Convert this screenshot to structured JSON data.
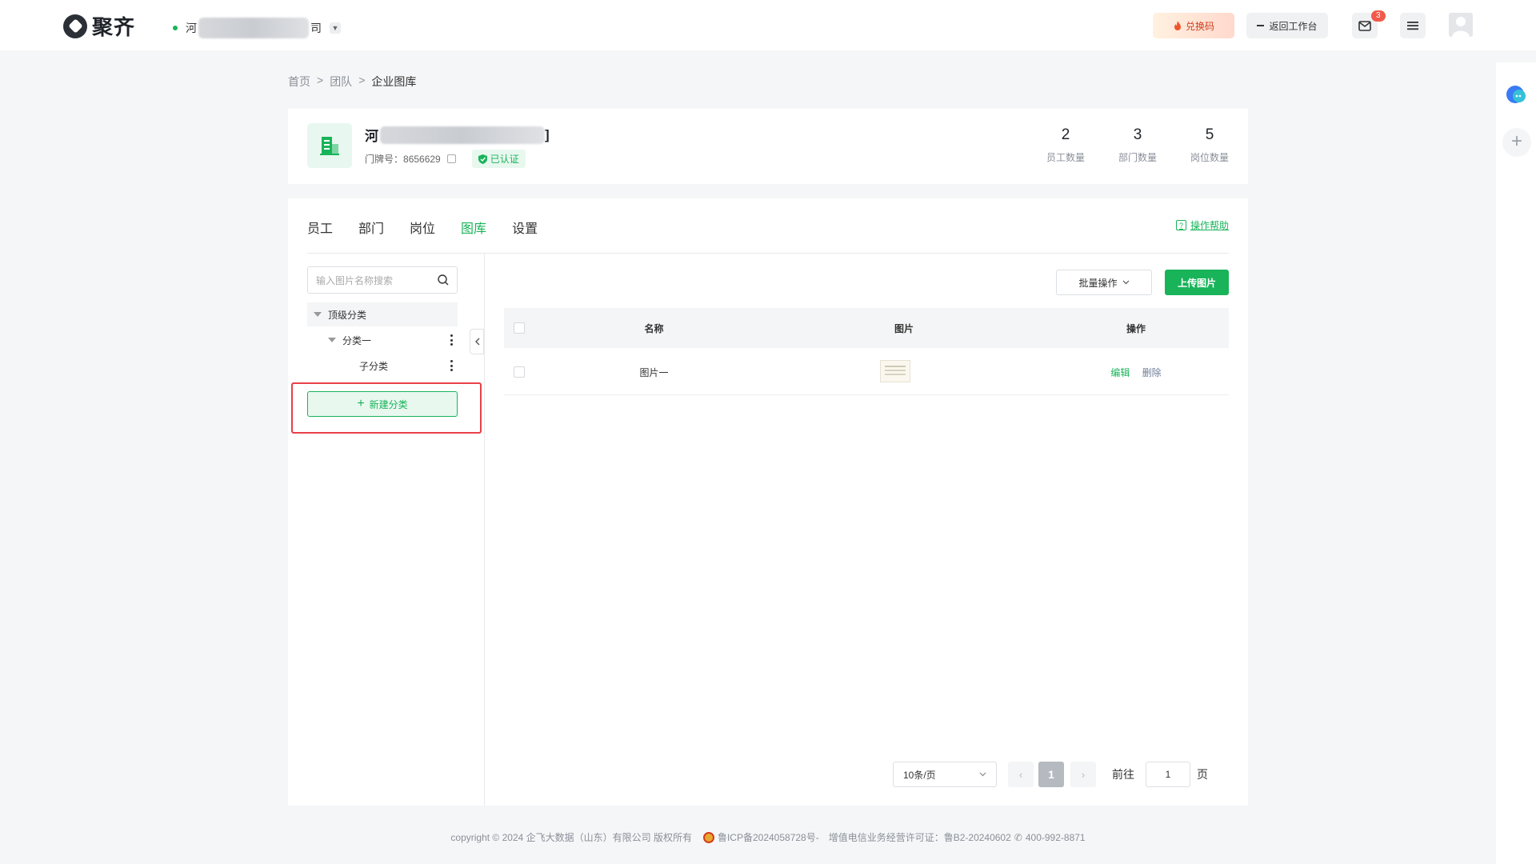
{
  "topbar": {
    "logo_text": "聚齐",
    "company_prefix": "河",
    "company_suffix": "司",
    "redeem_label": "兑换码",
    "back_label": "返回工作台",
    "mail_badge": "3"
  },
  "breadcrumb": [
    "首页",
    "团队",
    "企业图库"
  ],
  "org": {
    "name_prefix": "河",
    "name_suffix": "]",
    "door_label": "门牌号：",
    "door_number": "8656629",
    "verified_label": "已认证",
    "stats": [
      {
        "value": "2",
        "label": "员工数量"
      },
      {
        "value": "3",
        "label": "部门数量"
      },
      {
        "value": "5",
        "label": "岗位数量"
      }
    ]
  },
  "tabs": [
    "员工",
    "部门",
    "岗位",
    "图库",
    "设置"
  ],
  "active_tab": "图库",
  "help_label": "操作帮助",
  "sidebar": {
    "search_placeholder": "输入图片名称搜索",
    "tree": {
      "top": "顶级分类",
      "child": "分类一",
      "grandchild": "子分类"
    },
    "new_category": "新建分类"
  },
  "toolbar": {
    "batch_label": "批量操作",
    "upload_label": "上传图片"
  },
  "table": {
    "headers": [
      "名称",
      "图片",
      "操作"
    ],
    "rows": [
      {
        "name": "图片一",
        "edit": "编辑",
        "delete": "删除"
      }
    ]
  },
  "pagination": {
    "page_size": "10条/页",
    "current_page": "1",
    "goto_label": "前往",
    "goto_value": "1",
    "page_unit": "页"
  },
  "footer": {
    "copyright": "copyright © 2024 企飞大数据（山东）有限公司 版权所有",
    "icp": "鲁ICP备2024058728号-",
    "license": "增值电信业务经营许可证：鲁B2-20240602",
    "phone": "400-992-8871"
  },
  "colors": {
    "accent": "#19b35a",
    "highlight_border": "#e8404a"
  }
}
